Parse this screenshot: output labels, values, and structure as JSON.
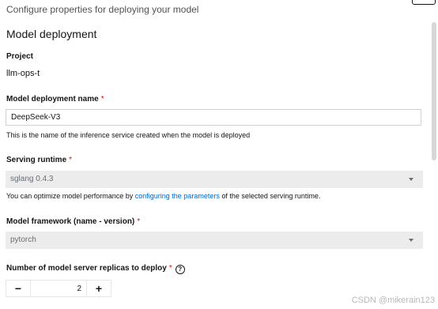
{
  "header": {
    "subtitle": "Configure properties for deploying your model"
  },
  "section": {
    "title": "Model deployment"
  },
  "project": {
    "label": "Project",
    "value": "llm-ops-t"
  },
  "deployment_name": {
    "label": "Model deployment name",
    "required_mark": "*",
    "value": "DeepSeek-V3",
    "helper": "This is the name of the inference service created when the model is deployed"
  },
  "serving_runtime": {
    "label": "Serving runtime",
    "required_mark": "*",
    "selected": "sglang 0.4.3",
    "helper_prefix": "You can optimize model performance by ",
    "helper_link": "configuring the parameters",
    "helper_suffix": " of the selected serving runtime."
  },
  "model_framework": {
    "label": "Model framework (name - version)",
    "required_mark": "*",
    "selected": "pytorch"
  },
  "replicas": {
    "label": "Number of model server replicas to deploy",
    "required_mark": "*",
    "help_glyph": "?",
    "minus": "−",
    "plus": "+",
    "value": "2"
  },
  "watermark": "CSDN @mikerain123"
}
